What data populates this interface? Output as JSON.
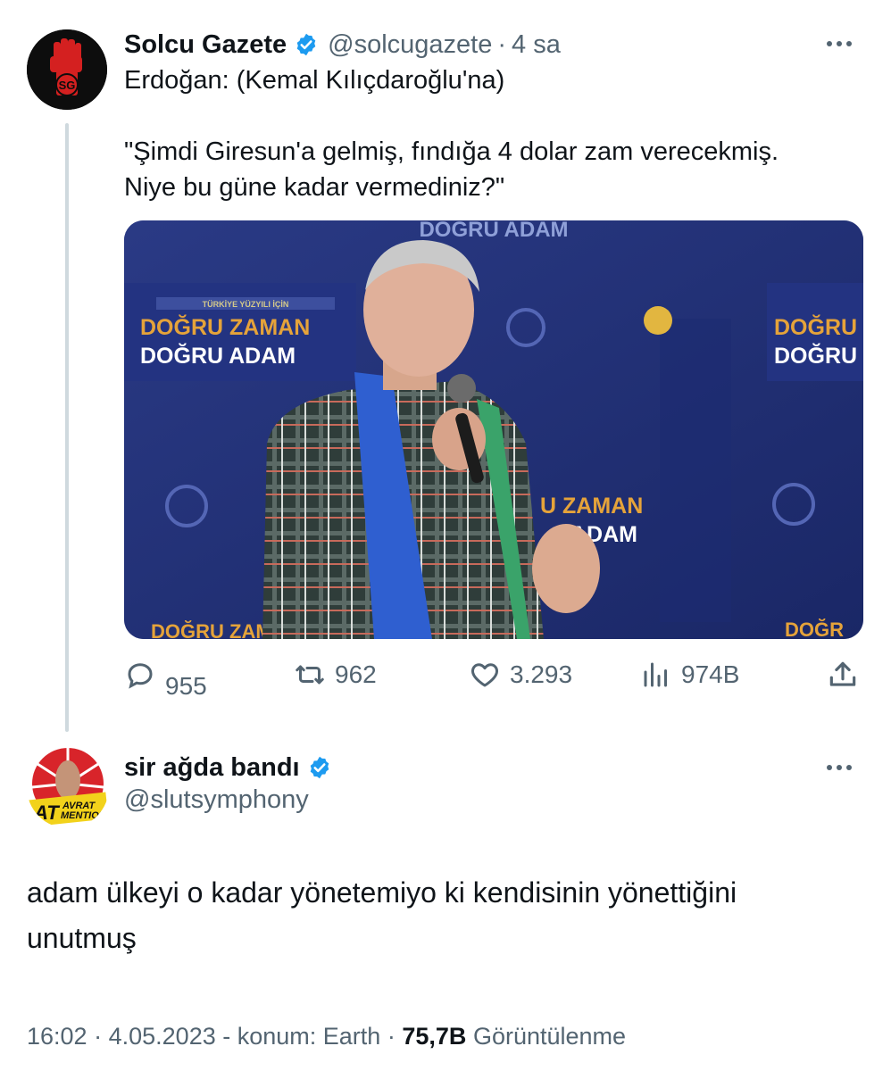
{
  "quoted_tweet": {
    "author_name": "Solcu Gazete",
    "author_handle": "@solcugazete",
    "separator": "·",
    "time": "4 sa",
    "avatar_initials": "SG",
    "text_line_1": "Erdoğan: (Kemal Kılıçdaroğlu'na)",
    "text_line_2": "\"Şimdi Giresun'a gelmiş, fındığa 4 dolar zam verecekmiş.",
    "text_line_3": "Niye bu güne kadar vermediniz?\"",
    "media_texts": {
      "top_banner": "DOĞRU ADAM",
      "left_banner_small": "TÜRKİYE YÜZYILI İÇİN",
      "left_banner_line1": "DOĞRU ZAMAN",
      "left_banner_line2": "DOĞRU ADAM",
      "right_banner_line1": "DOĞRU",
      "right_banner_line2": "DOĞRU",
      "center_banner_line1": "U ZAMAN",
      "center_banner_line2": "ADAM",
      "bottom_left": "DOĞRU ZAM",
      "bottom_right": "DOĞR"
    },
    "stats": {
      "replies": "955",
      "retweets": "962",
      "likes": "3.293",
      "views": "974B"
    }
  },
  "reply_tweet": {
    "author_name": "sir ağda bandı",
    "author_handle": "@slutsymphony",
    "avatar_text_1": "AT",
    "avatar_text_2": "AVRAT",
    "avatar_text_3": "MENTION",
    "text_line_1": "adam ülkeyi o kadar yönetemiyo ki kendisinin yönettiğini",
    "text_line_2": "unutmuş",
    "meta": {
      "time": "16:02",
      "sep1": "·",
      "date": "4.05.2023",
      "location": "- konum: Earth",
      "sep2": "·",
      "views_count": "75,7B",
      "views_label": "Görüntülenme"
    }
  },
  "colors": {
    "verified_blue": "#1d9bf0",
    "secondary_text": "#536471",
    "thread_line": "#cfd9de"
  }
}
